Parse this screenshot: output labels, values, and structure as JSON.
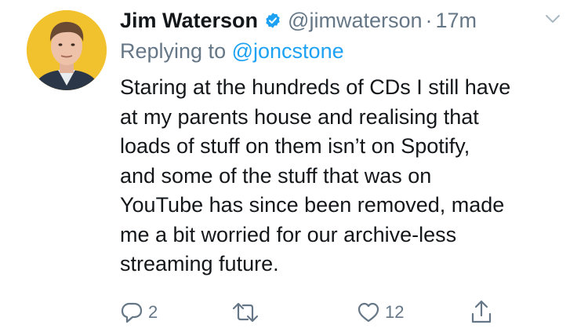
{
  "tweet": {
    "author_name": "Jim Waterson",
    "handle": "@jimwaterson",
    "separator": "·",
    "time": "17m",
    "replying_prefix": "Replying to",
    "replying_to": "@joncstone",
    "body_lines": [
      "Staring at the hundreds of CDs I still have",
      "at my parents house and realising that",
      "loads of stuff on them isn’t on Spotify,",
      "and some of the stuff that was on",
      "YouTube has since been removed, made",
      "me a bit worried for our archive-less",
      "streaming future."
    ],
    "reply_count": "2",
    "like_count": "12"
  },
  "icons": {
    "verified": "verified-badge-icon",
    "menu": "chevron-down-icon",
    "reply": "reply-icon",
    "retweet": "retweet-icon",
    "like": "heart-icon",
    "share": "share-icon"
  },
  "colors": {
    "text": "#14171a",
    "secondary": "#657786",
    "accent": "#1da1f2",
    "avatar_bg": "#f2c12e"
  }
}
